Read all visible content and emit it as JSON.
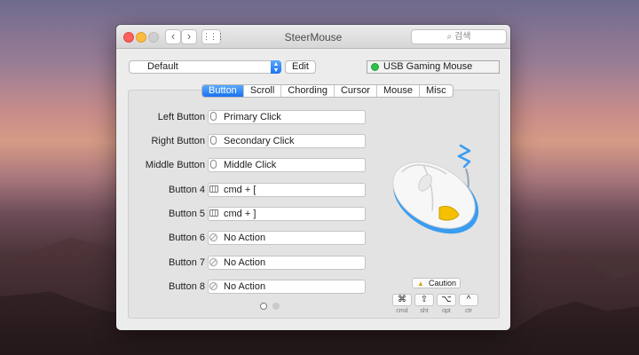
{
  "window": {
    "title": "SteerMouse",
    "search_placeholder": "검색",
    "nav_back": "‹",
    "nav_forward": "›",
    "grid_label": "⋮⋮⋮"
  },
  "profile": {
    "selected": "Default",
    "edit_label": "Edit",
    "device": "USB Gaming Mouse",
    "device_status_color": "#2ec04a"
  },
  "tabs": [
    {
      "label": "Button",
      "active": true
    },
    {
      "label": "Scroll",
      "active": false
    },
    {
      "label": "Chording",
      "active": false
    },
    {
      "label": "Cursor",
      "active": false
    },
    {
      "label": "Mouse",
      "active": false
    },
    {
      "label": "Misc",
      "active": false
    }
  ],
  "buttons": [
    {
      "label": "Left Button",
      "action": "Primary Click",
      "icon": "mouse-icon"
    },
    {
      "label": "Right Button",
      "action": "Secondary Click",
      "icon": "mouse-icon"
    },
    {
      "label": "Middle Button",
      "action": "Middle Click",
      "icon": "mouse-icon"
    },
    {
      "label": "Button 4",
      "action": "cmd + [",
      "icon": "keyboard-icon"
    },
    {
      "label": "Button 5",
      "action": "cmd + ]",
      "icon": "keyboard-icon"
    },
    {
      "label": "Button 6",
      "action": "No Action",
      "icon": "no-action-icon"
    },
    {
      "label": "Button 7",
      "action": "No Action",
      "icon": "no-action-icon"
    },
    {
      "label": "Button 8",
      "action": "No Action",
      "icon": "no-action-icon"
    }
  ],
  "pager": {
    "current": 1,
    "total": 2
  },
  "caution_label": "Caution",
  "modifiers": [
    {
      "symbol": "⌘",
      "label": "cmd"
    },
    {
      "symbol": "⇧",
      "label": "sht"
    },
    {
      "symbol": "⌥",
      "label": "opt"
    },
    {
      "symbol": "^",
      "label": "ctr"
    }
  ],
  "colors": {
    "accent": "#1a73f0",
    "mouse_accent": "#3a9cf0"
  }
}
